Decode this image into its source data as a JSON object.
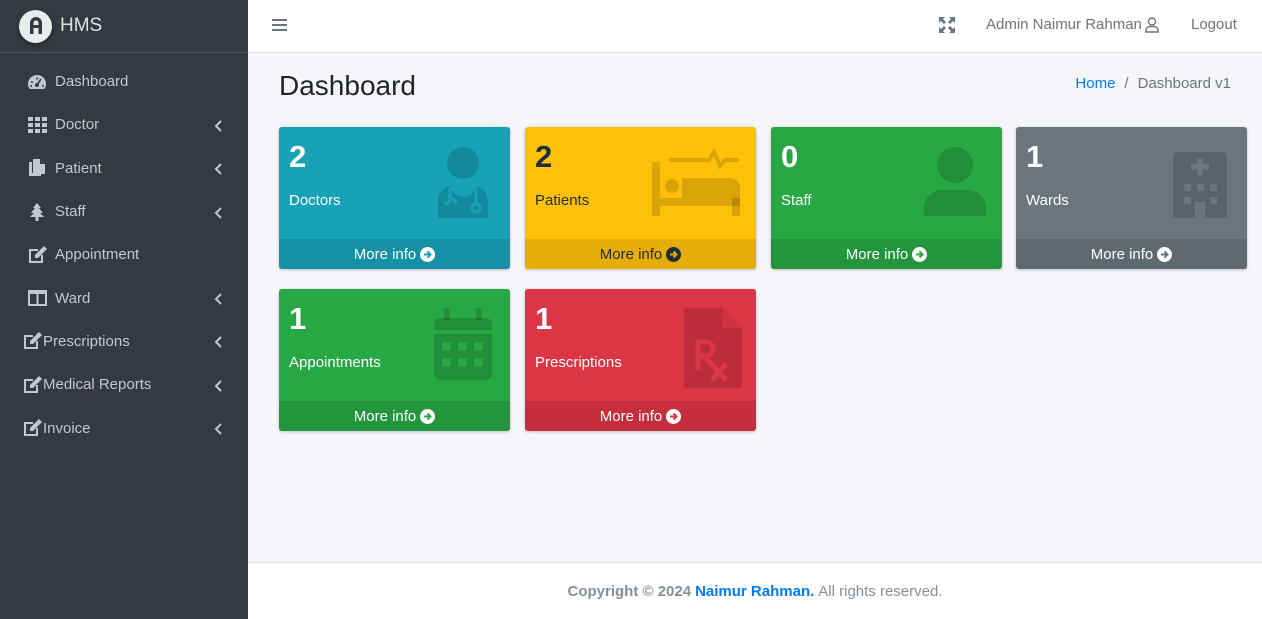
{
  "brand": {
    "name": "HMS"
  },
  "sidebar": {
    "items": [
      {
        "label": "Dashboard",
        "icon": "tachometer-icon",
        "has_caret": false
      },
      {
        "label": "Doctor",
        "icon": "grid-icon",
        "has_caret": true
      },
      {
        "label": "Patient",
        "icon": "copy-icon",
        "has_caret": true
      },
      {
        "label": "Staff",
        "icon": "tree-icon",
        "has_caret": true
      },
      {
        "label": "Appointment",
        "icon": "edit-icon",
        "has_caret": false
      },
      {
        "label": "Ward",
        "icon": "columns-icon",
        "has_caret": true
      },
      {
        "label": "Prescriptions",
        "icon": "edit-icon",
        "has_caret": true
      },
      {
        "label": "Medical Reports",
        "icon": "edit-icon",
        "has_caret": true
      },
      {
        "label": "Invoice",
        "icon": "edit-icon",
        "has_caret": true
      }
    ]
  },
  "header": {
    "user_name": "Admin Naimur Rahman",
    "logout_label": "Logout"
  },
  "content": {
    "title": "Dashboard",
    "breadcrumb": {
      "home": "Home",
      "separator": "/",
      "current": "Dashboard v1"
    }
  },
  "boxes": [
    {
      "count": "2",
      "label": "Doctors",
      "more": "More info",
      "color": "#17a2b8",
      "icon": "user-doctor-icon"
    },
    {
      "count": "2",
      "label": "Patients",
      "more": "More info",
      "color": "#ffc107",
      "icon": "bed-pulse-icon"
    },
    {
      "count": "0",
      "label": "Staff",
      "more": "More info",
      "color": "#28a745",
      "icon": "user-icon"
    },
    {
      "count": "1",
      "label": "Wards",
      "more": "More info",
      "color": "#6c757d",
      "icon": "hospital-icon"
    },
    {
      "count": "1",
      "label": "Appointments",
      "more": "More info",
      "color": "#28a745",
      "icon": "calendar-icon"
    },
    {
      "count": "1",
      "label": "Prescriptions",
      "more": "More info",
      "color": "#dc3545",
      "icon": "prescription-icon"
    }
  ],
  "footer": {
    "copyright": "Copyright © 2024",
    "author": "Naimur Rahman.",
    "rights": "All rights reserved."
  }
}
